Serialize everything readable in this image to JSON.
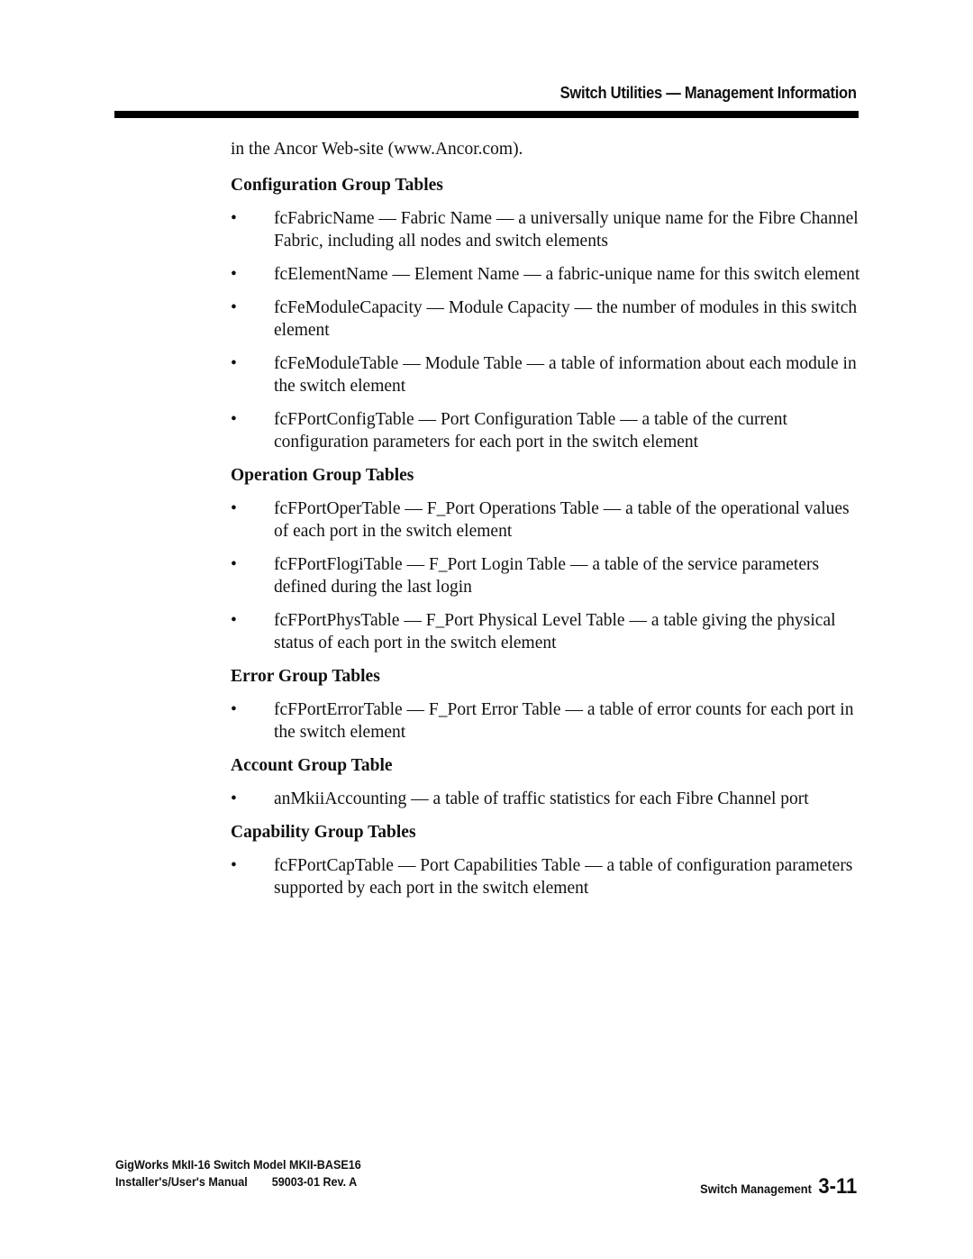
{
  "header": {
    "running_title": "Switch Utilities — Management Information"
  },
  "intro_text": "in the Ancor Web-site (www.Ancor.com).",
  "sections": [
    {
      "heading": "Configuration Group Tables",
      "items": [
        "fcFabricName — Fabric Name — a universally unique name for the Fibre Channel Fabric, including all nodes and switch elements",
        "fcElementName — Element Name — a fabric-unique name for this switch element",
        "fcFeModuleCapacity — Module Capacity — the number of modules in this switch element",
        "fcFeModuleTable — Module Table — a table of information about each module in the switch element",
        "fcFPortConfigTable — Port Configuration Table — a table of the current configuration parameters for each port in the switch element"
      ]
    },
    {
      "heading": "Operation Group Tables",
      "items": [
        "fcFPortOperTable — F_Port Operations Table — a table of the operational values of each port in the switch element",
        "fcFPortFlogiTable — F_Port Login Table — a table of the service parameters defined during the last login",
        "fcFPortPhysTable — F_Port Physical Level Table — a table giving the physical status of each port in the switch element"
      ]
    },
    {
      "heading": "Error Group Tables",
      "items": [
        "fcFPortErrorTable — F_Port Error Table — a table of error counts for each port in the switch element"
      ]
    },
    {
      "heading": "Account Group Table",
      "items": [
        "anMkiiAccounting — a table of traffic statistics for each Fibre Channel port"
      ]
    },
    {
      "heading": "Capability Group Tables",
      "items": [
        "fcFPortCapTable — Port Capabilities Table — a table of configuration parameters supported by each port in the switch element"
      ]
    }
  ],
  "bullet_glyph": "•",
  "footer": {
    "product_line": "GigWorks MkII-16 Switch Model MKII-BASE16",
    "manual_title": "Installer's/User's Manual",
    "doc_number": "59003-01 Rev. A",
    "section_name": "Switch Management",
    "page_number": "3-11"
  }
}
